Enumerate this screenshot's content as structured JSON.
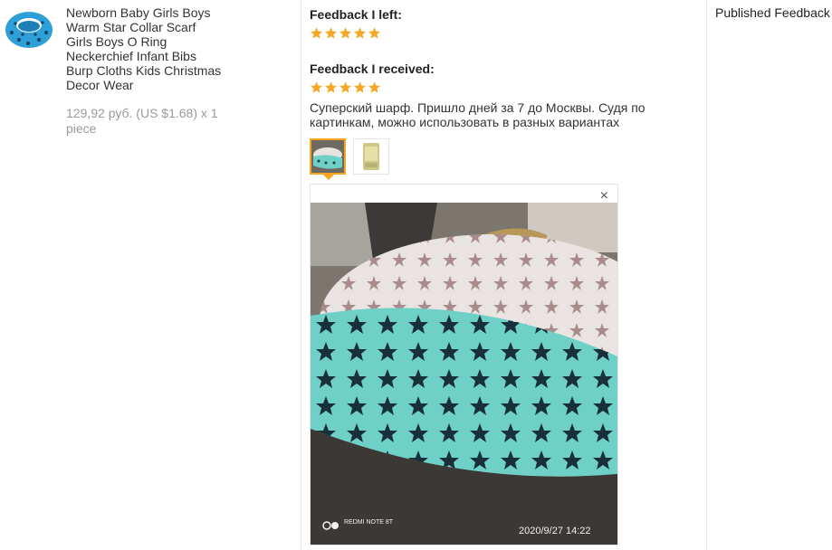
{
  "product": {
    "title": "Newborn Baby Girls Boys Warm Star Collar Scarf Girls Boys O Ring Neckerchief Infant Bibs Burp Cloths Kids Christmas Decor Wear",
    "price": "129,92 руб. (US $1.68) x 1 piece",
    "thumbnail_icon": "scarf-product-image"
  },
  "feedback": {
    "left_heading": "Feedback I left:",
    "left_rating": 5,
    "received_heading": "Feedback I received:",
    "received_rating": 5,
    "comment": "Суперский шарф. Пришло дней за 7 до Москвы. Судя по картинкам, можно использовать в разных вариантах",
    "close_symbol": "×",
    "photo_overlay_device": "REDMI NOTE 8T",
    "photo_overlay_timestamp": "2020/9/27  14:22"
  },
  "status": {
    "published_label": "Published Feedback"
  },
  "colors": {
    "star": "#f5a623",
    "scarf_blue": "#2f9fd8",
    "scarf_mint": "#6fd0c7",
    "divider": "#e8e8e8"
  }
}
